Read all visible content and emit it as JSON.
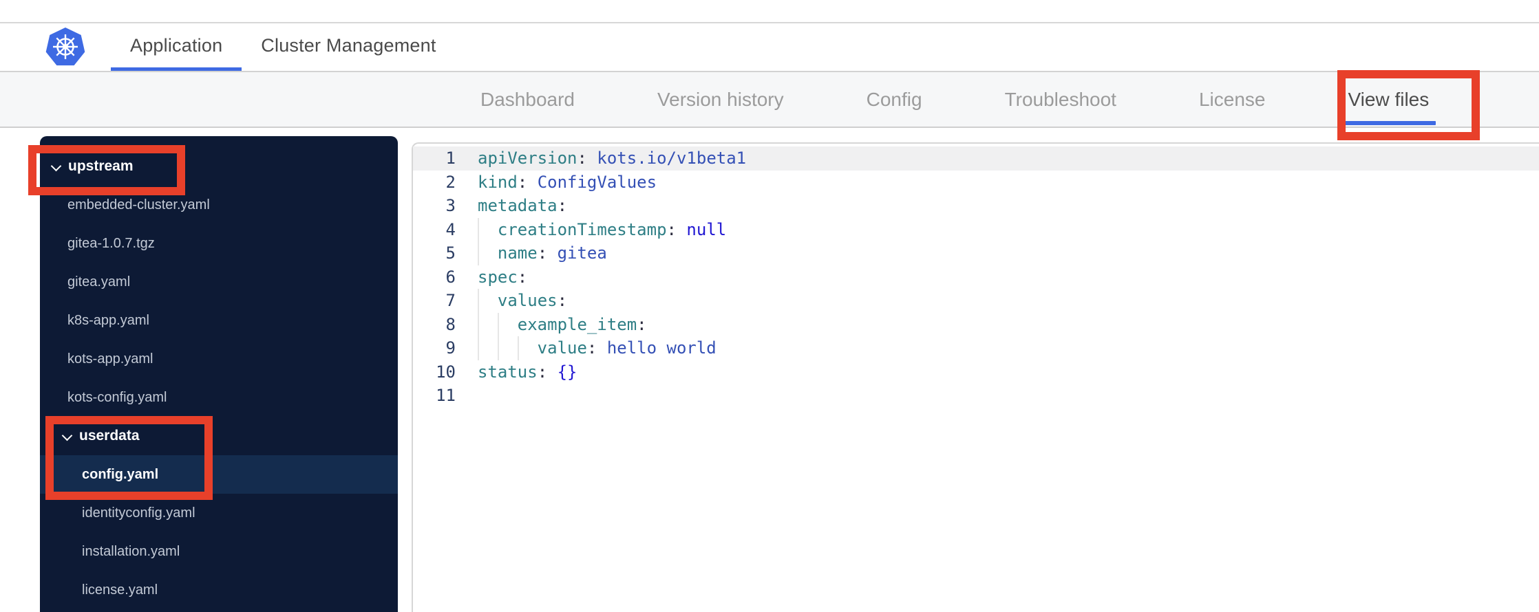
{
  "header": {
    "logo": "kubernetes-logo",
    "tabs": [
      {
        "label": "Application",
        "active": true
      },
      {
        "label": "Cluster Management",
        "active": false
      }
    ]
  },
  "nav": {
    "tabs": [
      {
        "label": "Dashboard",
        "active": false
      },
      {
        "label": "Version history",
        "active": false
      },
      {
        "label": "Config",
        "active": false
      },
      {
        "label": "Troubleshoot",
        "active": false
      },
      {
        "label": "License",
        "active": false
      },
      {
        "label": "View files",
        "active": true
      }
    ]
  },
  "sidebar": {
    "items": [
      {
        "label": "upstream",
        "type": "folder",
        "level": 0,
        "expanded": true
      },
      {
        "label": "embedded-cluster.yaml",
        "type": "file",
        "level": 1
      },
      {
        "label": "gitea-1.0.7.tgz",
        "type": "file",
        "level": 1
      },
      {
        "label": "gitea.yaml",
        "type": "file",
        "level": 1
      },
      {
        "label": "k8s-app.yaml",
        "type": "file",
        "level": 1
      },
      {
        "label": "kots-app.yaml",
        "type": "file",
        "level": 1
      },
      {
        "label": "kots-config.yaml",
        "type": "file",
        "level": 1
      },
      {
        "label": "userdata",
        "type": "folder",
        "level": 1,
        "expanded": true
      },
      {
        "label": "config.yaml",
        "type": "file",
        "level": 2,
        "selected": true
      },
      {
        "label": "identityconfig.yaml",
        "type": "file",
        "level": 2
      },
      {
        "label": "installation.yaml",
        "type": "file",
        "level": 2
      },
      {
        "label": "license.yaml",
        "type": "file",
        "level": 2
      }
    ]
  },
  "editor": {
    "active_line": 1,
    "lines": [
      {
        "num": "1",
        "key": "apiVersion",
        "colon": ":",
        "value": "kots.io/v1beta1"
      },
      {
        "num": "2",
        "key": "kind",
        "colon": ":",
        "value": "ConfigValues"
      },
      {
        "num": "3",
        "key": "metadata",
        "colon": ":",
        "value": ""
      },
      {
        "num": "4",
        "key": "creationTimestamp",
        "colon": ":",
        "value": "null"
      },
      {
        "num": "5",
        "key": "name",
        "colon": ":",
        "value": "gitea"
      },
      {
        "num": "6",
        "key": "spec",
        "colon": ":",
        "value": ""
      },
      {
        "num": "7",
        "key": "values",
        "colon": ":",
        "value": ""
      },
      {
        "num": "8",
        "key": "example_item",
        "colon": ":",
        "value": ""
      },
      {
        "num": "9",
        "key": "value",
        "colon": ":",
        "value": "hello world"
      },
      {
        "num": "10",
        "key": "status",
        "colon": ":",
        "value": "{}"
      },
      {
        "num": "11",
        "key": "",
        "colon": "",
        "value": ""
      }
    ]
  },
  "annotations": {
    "color": "#e8402a",
    "boxes": [
      "view-files-tab",
      "upstream-folder",
      "userdata-and-config-yaml"
    ]
  },
  "colors": {
    "brand_blue": "#3e6ae3",
    "annotation_red": "#e8402a",
    "sidebar_bg": "#0d1a35",
    "sidebar_selected_bg": "#142c4e",
    "nav_bg": "#f6f7f8",
    "code_key_teal": "#2e7e85",
    "code_value_blue": "#3450b5",
    "code_constant_blue": "#2016d2",
    "gutter_number": "#2b3d63"
  }
}
